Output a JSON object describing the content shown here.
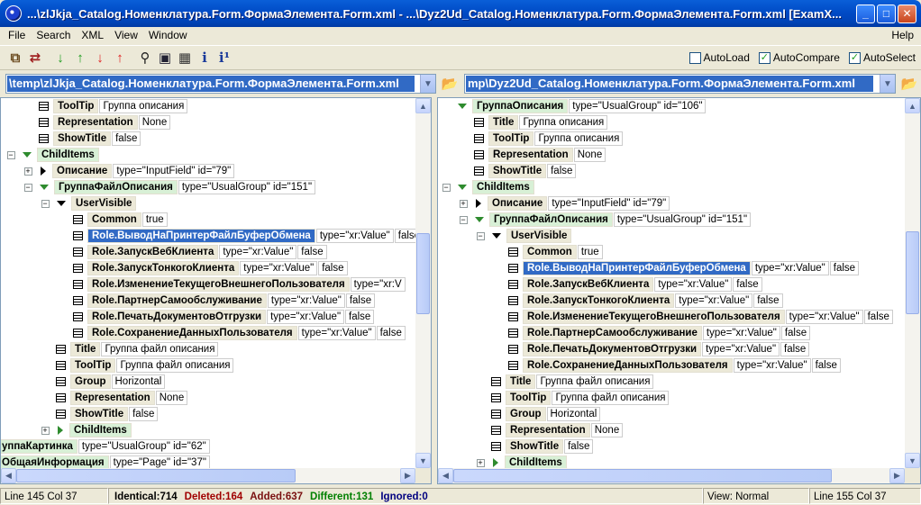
{
  "window": {
    "title": "...\\zlJkja_Catalog.Номенклатура.Form.ФормаЭлемента.Form.xml - ...\\Dyz2Ud_Catalog.Номенклатура.Form.ФормаЭлемента.Form.xml [ExamX...",
    "minimize": "_",
    "maximize": "□",
    "close": "✕"
  },
  "menu": [
    "File",
    "Search",
    "XML",
    "View",
    "Window"
  ],
  "menu_help": "Help",
  "toolbar": {
    "checks": [
      {
        "label": "AutoLoad",
        "checked": false
      },
      {
        "label": "AutoCompare",
        "checked": true
      },
      {
        "label": "AutoSelect",
        "checked": true
      }
    ]
  },
  "left_path": "\\temp\\zlJkja_Catalog.Номенклатура.Form.ФормаЭлемента.Form.xml",
  "right_path": "mp\\Dyz2Ud_Catalog.Номенклатура.Form.ФормаЭлемента.Form.xml",
  "left_rows": [
    {
      "i": 1,
      "ctl": "",
      "m": "leaf",
      "n": "ToolTip",
      "v": "Группа описания"
    },
    {
      "i": 1,
      "ctl": "",
      "m": "leaf",
      "n": "Representation",
      "v": "None"
    },
    {
      "i": 1,
      "ctl": "",
      "m": "leaf",
      "n": "ShowTitle",
      "v": "false"
    },
    {
      "i": 0,
      "ctl": "-",
      "m": "down-g",
      "n": "ChildItems",
      "v": "",
      "g": true
    },
    {
      "i": 1,
      "ctl": "+",
      "m": "right",
      "n": "Описание",
      "v": "type=\"InputField\" id=\"79\""
    },
    {
      "i": 1,
      "ctl": "-",
      "m": "down-g",
      "n": "ГруппаФайлОписания",
      "v": "type=\"UsualGroup\" id=\"151\"",
      "g": true
    },
    {
      "i": 2,
      "ctl": "-",
      "m": "down",
      "n": "UserVisible",
      "v": ""
    },
    {
      "i": 3,
      "ctl": "",
      "m": "leaf",
      "n": "Common",
      "v": "true"
    },
    {
      "i": 3,
      "ctl": "",
      "m": "leaf",
      "n": "Role.ВыводНаПринтерФайлБуферОбмена",
      "v": "type=\"xr:Value\"",
      "v2": "false",
      "s": true
    },
    {
      "i": 3,
      "ctl": "",
      "m": "leaf",
      "n": "Role.ЗапускВебКлиента",
      "v": "type=\"xr:Value\"",
      "v2": "false"
    },
    {
      "i": 3,
      "ctl": "",
      "m": "leaf",
      "n": "Role.ЗапускТонкогоКлиента",
      "v": "type=\"xr:Value\"",
      "v2": "false"
    },
    {
      "i": 3,
      "ctl": "",
      "m": "leaf",
      "n": "Role.ИзменениеТекущегоВнешнегоПользователя",
      "v": "type=\"xr:V"
    },
    {
      "i": 3,
      "ctl": "",
      "m": "leaf",
      "n": "Role.ПартнерСамообслуживание",
      "v": "type=\"xr:Value\"",
      "v2": "false"
    },
    {
      "i": 3,
      "ctl": "",
      "m": "leaf",
      "n": "Role.ПечатьДокументовОтгрузки",
      "v": "type=\"xr:Value\"",
      "v2": "false"
    },
    {
      "i": 3,
      "ctl": "",
      "m": "leaf",
      "n": "Role.СохранениеДанныхПользователя",
      "v": "type=\"xr:Value\"",
      "v2": "false"
    },
    {
      "i": 2,
      "ctl": "",
      "m": "leaf",
      "n": "Title",
      "v": "Группа файл описания"
    },
    {
      "i": 2,
      "ctl": "",
      "m": "leaf",
      "n": "ToolTip",
      "v": "Группа файл описания"
    },
    {
      "i": 2,
      "ctl": "",
      "m": "leaf",
      "n": "Group",
      "v": "Horizontal"
    },
    {
      "i": 2,
      "ctl": "",
      "m": "leaf",
      "n": "Representation",
      "v": "None"
    },
    {
      "i": 2,
      "ctl": "",
      "m": "leaf",
      "n": "ShowTitle",
      "v": "false"
    },
    {
      "i": 2,
      "ctl": "+",
      "m": "right-g",
      "n": "ChildItems",
      "v": "",
      "g": true
    },
    {
      "i": -1,
      "ctl": "",
      "m": "",
      "n": "уппаКартинка",
      "v": "type=\"UsualGroup\" id=\"62\"",
      "g": true
    },
    {
      "i": -1,
      "ctl": "",
      "m": "",
      "n": "ОбщаяИнформация",
      "v": "type=\"Page\" id=\"37\"",
      "g": true
    }
  ],
  "right_rows": [
    {
      "i": 0,
      "ctl": "",
      "m": "down-g",
      "n": "ГруппаОписания",
      "v": "type=\"UsualGroup\" id=\"106\"",
      "g": true
    },
    {
      "i": 1,
      "ctl": "",
      "m": "leaf",
      "n": "Title",
      "v": "Группа описания"
    },
    {
      "i": 1,
      "ctl": "",
      "m": "leaf",
      "n": "ToolTip",
      "v": "Группа описания"
    },
    {
      "i": 1,
      "ctl": "",
      "m": "leaf",
      "n": "Representation",
      "v": "None"
    },
    {
      "i": 1,
      "ctl": "",
      "m": "leaf",
      "n": "ShowTitle",
      "v": "false"
    },
    {
      "i": 0,
      "ctl": "-",
      "m": "down-g",
      "n": "ChildItems",
      "v": "",
      "g": true
    },
    {
      "i": 1,
      "ctl": "+",
      "m": "right",
      "n": "Описание",
      "v": "type=\"InputField\" id=\"79\""
    },
    {
      "i": 1,
      "ctl": "-",
      "m": "down-g",
      "n": "ГруппаФайлОписания",
      "v": "type=\"UsualGroup\" id=\"151\"",
      "g": true
    },
    {
      "i": 2,
      "ctl": "-",
      "m": "down",
      "n": "UserVisible",
      "v": ""
    },
    {
      "i": 3,
      "ctl": "",
      "m": "leaf",
      "n": "Common",
      "v": "true"
    },
    {
      "i": 3,
      "ctl": "",
      "m": "leaf",
      "n": "Role.ВыводНаПринтерФайлБуферОбмена",
      "v": "type=\"xr:Value\"",
      "v2": "false",
      "s": true
    },
    {
      "i": 3,
      "ctl": "",
      "m": "leaf",
      "n": "Role.ЗапускВебКлиента",
      "v": "type=\"xr:Value\"",
      "v2": "false"
    },
    {
      "i": 3,
      "ctl": "",
      "m": "leaf",
      "n": "Role.ЗапускТонкогоКлиента",
      "v": "type=\"xr:Value\"",
      "v2": "false"
    },
    {
      "i": 3,
      "ctl": "",
      "m": "leaf",
      "n": "Role.ИзменениеТекущегоВнешнегоПользователя",
      "v": "type=\"xr:Value\"",
      "v2": "false"
    },
    {
      "i": 3,
      "ctl": "",
      "m": "leaf",
      "n": "Role.ПартнерСамообслуживание",
      "v": "type=\"xr:Value\"",
      "v2": "false"
    },
    {
      "i": 3,
      "ctl": "",
      "m": "leaf",
      "n": "Role.ПечатьДокументовОтгрузки",
      "v": "type=\"xr:Value\"",
      "v2": "false"
    },
    {
      "i": 3,
      "ctl": "",
      "m": "leaf",
      "n": "Role.СохранениеДанныхПользователя",
      "v": "type=\"xr:Value\"",
      "v2": "false"
    },
    {
      "i": 2,
      "ctl": "",
      "m": "leaf",
      "n": "Title",
      "v": "Группа файл описания"
    },
    {
      "i": 2,
      "ctl": "",
      "m": "leaf",
      "n": "ToolTip",
      "v": "Группа файл описания"
    },
    {
      "i": 2,
      "ctl": "",
      "m": "leaf",
      "n": "Group",
      "v": "Horizontal"
    },
    {
      "i": 2,
      "ctl": "",
      "m": "leaf",
      "n": "Representation",
      "v": "None"
    },
    {
      "i": 2,
      "ctl": "",
      "m": "leaf",
      "n": "ShowTitle",
      "v": "false"
    },
    {
      "i": 2,
      "ctl": "+",
      "m": "right-g",
      "n": "ChildItems",
      "v": "",
      "g": true
    }
  ],
  "status": {
    "left_pos": "Line 145  Col 37",
    "identical": "Identical:714",
    "deleted": "Deleted:164",
    "added": "Added:637",
    "different": "Different:131",
    "ignored": "Ignored:0",
    "view": "View: Normal",
    "right_pos": "Line 155  Col 37"
  },
  "colors": {
    "deleted": "#a00000",
    "added": "#7a1010",
    "different": "#008000",
    "ignored": "#000080",
    "selection": "#316ac5",
    "green_node": "#d8f0d6"
  }
}
